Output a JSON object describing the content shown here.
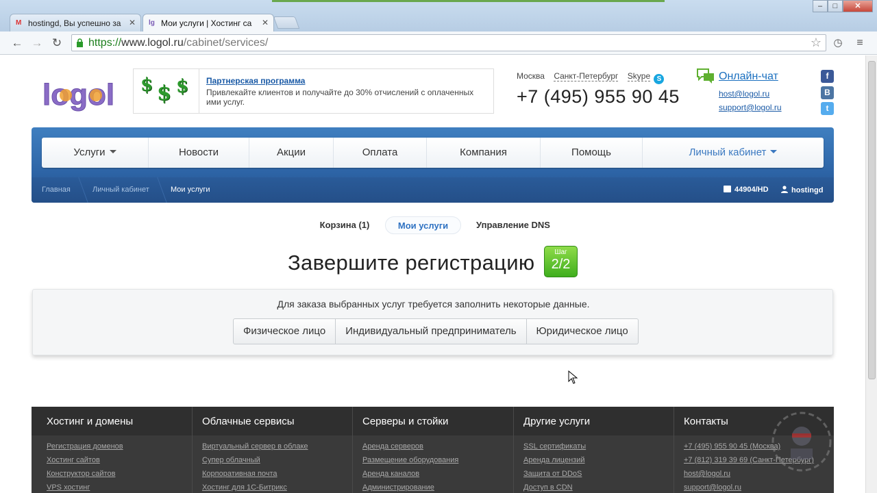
{
  "browser": {
    "tabs": [
      {
        "label": "hostingd, Вы успешно за",
        "favicon": "gmail-icon"
      },
      {
        "label": "Мои услуги | Хостинг са",
        "favicon": "logol-icon"
      }
    ],
    "url": {
      "scheme": "https://",
      "host": "www.logol.ru",
      "path": "/cabinet/services/"
    }
  },
  "header": {
    "logo_text": "logol",
    "partner": {
      "title": "Партнерская программа",
      "description": "Привлекайте клиентов и получайте до 30% отчислений с оплаченных ими услуг."
    },
    "cities": [
      "Москва",
      "Санкт-Петербург",
      "Skype"
    ],
    "phone": "+7 (495) 955 90 45",
    "chat": "Онлайн-чат",
    "emails": [
      "host@logol.ru",
      "support@logol.ru"
    ],
    "social": [
      "f",
      "B",
      "t"
    ]
  },
  "nav": {
    "items": [
      "Услуги",
      "Новости",
      "Акции",
      "Оплата",
      "Компания",
      "Помощь",
      "Личный кабинет"
    ]
  },
  "breadcrumbs": [
    "Главная",
    "Личный кабинет",
    "Мои услуги"
  ],
  "account": {
    "id": "44904/HD",
    "user": "hostingd"
  },
  "subtabs": [
    "Корзина (1)",
    "Мои услуги",
    "Управление DNS"
  ],
  "main": {
    "heading": "Завершите регистрацию",
    "step_label": "Шаг",
    "step_value": "2/2",
    "message": "Для заказа выбранных услуг требуется заполнить некоторые данные.",
    "options": [
      "Физическое лицо",
      "Индивидуальный предприниматель",
      "Юридическое лицо"
    ]
  },
  "footer": {
    "columns": [
      {
        "title": "Хостинг и домены",
        "links": [
          "Регистрация доменов",
          "Хостинг сайтов",
          "Конструктор сайтов",
          "VPS хостинг"
        ]
      },
      {
        "title": "Облачные сервисы",
        "links": [
          "Виртуальный сервер в облаке",
          "Супер облачный",
          "Корпоративная почта",
          "Хостинг для 1С-Битрикс"
        ]
      },
      {
        "title": "Серверы и стойки",
        "links": [
          "Аренда серверов",
          "Размещение оборудования",
          "Аренда каналов",
          "Администрирование"
        ]
      },
      {
        "title": "Другие услуги",
        "links": [
          "SSL сертификаты",
          "Аренда лицензий",
          "Защита от DDoS",
          "Доступ в CDN"
        ]
      },
      {
        "title": "Контакты",
        "links": [
          "+7 (495) 955 90 45",
          "+7 (812) 319 39 69",
          "host@logol.ru",
          "support@logol.ru"
        ],
        "notes": [
          "(Москва)",
          "(Санкт-Петербург)"
        ]
      }
    ]
  },
  "colors": {
    "brand_blue": "#2d64a6",
    "link": "#1a5aa6",
    "step_green": "#3fae1e"
  }
}
